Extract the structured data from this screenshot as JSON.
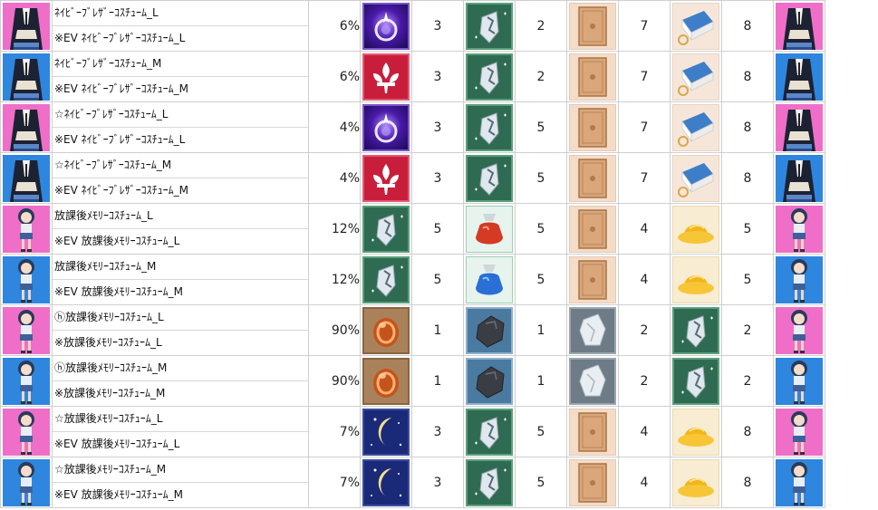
{
  "rows": [
    {
      "avatar_bg": "pink",
      "avatar": "blazer-costume-icon",
      "name_top": "ﾈｲﾋﾞｰﾌﾞﾚｻﾞｰｺｽﾁｭｰﾑ_L",
      "name_bottom": "※EV ﾈｲﾋﾞｰﾌﾞﾚｻﾞｰｺｽﾁｭｰﾑ_L",
      "rate": "6%",
      "m1": "purple-orb",
      "q1": "3",
      "m2": "shard-green",
      "q2": "2",
      "m3": "scroll",
      "q3": "7",
      "m4": "book",
      "q4": "8",
      "result_bg": "pink",
      "result": "blazer-costume-icon"
    },
    {
      "avatar_bg": "blue",
      "avatar": "blazer-costume-icon",
      "name_top": "ﾈｲﾋﾞｰﾌﾞﾚｻﾞｰｺｽﾁｭｰﾑ_M",
      "name_bottom": "※EV ﾈｲﾋﾞｰﾌﾞﾚｻﾞｰｺｽﾁｭｰﾑ_M",
      "rate": "6%",
      "m1": "fleur",
      "q1": "3",
      "m2": "shard-green",
      "q2": "2",
      "m3": "scroll",
      "q3": "7",
      "m4": "book",
      "q4": "8",
      "result_bg": "blue",
      "result": "blazer-costume-icon"
    },
    {
      "avatar_bg": "pink",
      "avatar": "blazer-costume-icon",
      "name_top": "☆ﾈｲﾋﾞｰﾌﾞﾚｻﾞｰｺｽﾁｭｰﾑ_L",
      "name_bottom": "※EV ﾈｲﾋﾞｰﾌﾞﾚｻﾞｰｺｽﾁｭｰﾑ_L",
      "rate": "4%",
      "m1": "purple-orb",
      "q1": "3",
      "m2": "shard-green",
      "q2": "5",
      "m3": "scroll",
      "q3": "7",
      "m4": "book",
      "q4": "8",
      "result_bg": "pink",
      "result": "blazer-costume-icon"
    },
    {
      "avatar_bg": "blue",
      "avatar": "blazer-costume-icon",
      "name_top": "☆ﾈｲﾋﾞｰﾌﾞﾚｻﾞｰｺｽﾁｭｰﾑ_M",
      "name_bottom": "※EV ﾈｲﾋﾞｰﾌﾞﾚｻﾞｰｺｽﾁｭｰﾑ_M",
      "rate": "4%",
      "m1": "fleur",
      "q1": "3",
      "m2": "shard-green",
      "q2": "5",
      "m3": "scroll",
      "q3": "7",
      "m4": "book",
      "q4": "8",
      "result_bg": "blue",
      "result": "blazer-costume-icon"
    },
    {
      "avatar_bg": "pink",
      "avatar": "memory-costume-icon",
      "name_top": "放課後ﾒﾓﾘｰｺｽﾁｭｰﾑ_L",
      "name_bottom": "※EV 放課後ﾒﾓﾘｰｺｽﾁｭｰﾑ_L",
      "rate": "12%",
      "m1": "shard-green",
      "q1": "5",
      "m2": "red-gem",
      "q2": "5",
      "m3": "scroll",
      "q3": "4",
      "m4": "hat",
      "q4": "5",
      "result_bg": "pink",
      "result": "memory-costume-icon"
    },
    {
      "avatar_bg": "blue",
      "avatar": "memory-costume-icon",
      "name_top": "放課後ﾒﾓﾘｰｺｽﾁｭｰﾑ_M",
      "name_bottom": "※EV 放課後ﾒﾓﾘｰｺｽﾁｭｰﾑ_M",
      "rate": "12%",
      "m1": "shard-green",
      "q1": "5",
      "m2": "blue-gem",
      "q2": "5",
      "m3": "scroll",
      "q3": "4",
      "m4": "hat",
      "q4": "5",
      "result_bg": "blue",
      "result": "memory-costume-icon"
    },
    {
      "avatar_bg": "pink",
      "avatar": "memory-costume-icon",
      "name_top": "ⓗ放課後ﾒﾓﾘｰｺｽﾁｭｰﾑ_L",
      "name_bottom": "※放課後ﾒﾓﾘｰｺｽﾁｭｰﾑ_L",
      "rate": "90%",
      "m1": "orange-orb",
      "q1": "1",
      "m2": "stone",
      "q2": "1",
      "m3": "crystal",
      "q3": "2",
      "m4": "shard-green",
      "q4": "2",
      "result_bg": "pink",
      "result": "memory-costume-icon"
    },
    {
      "avatar_bg": "blue",
      "avatar": "memory-costume-icon",
      "name_top": "ⓗ放課後ﾒﾓﾘｰｺｽﾁｭｰﾑ_M",
      "name_bottom": "※放課後ﾒﾓﾘｰｺｽﾁｭｰﾑ_M",
      "rate": "90%",
      "m1": "orange-orb",
      "q1": "1",
      "m2": "stone",
      "q2": "1",
      "m3": "crystal",
      "q3": "2",
      "m4": "shard-green",
      "q4": "2",
      "result_bg": "blue",
      "result": "memory-costume-icon"
    },
    {
      "avatar_bg": "pink",
      "avatar": "memory-costume-icon",
      "name_top": "☆放課後ﾒﾓﾘｰｺｽﾁｭｰﾑ_L",
      "name_bottom": "※EV 放課後ﾒﾓﾘｰｺｽﾁｭｰﾑ_L",
      "rate": "7%",
      "m1": "moon",
      "q1": "3",
      "m2": "shard-green",
      "q2": "5",
      "m3": "scroll",
      "q3": "4",
      "m4": "hat",
      "q4": "8",
      "result_bg": "pink",
      "result": "memory-costume-icon"
    },
    {
      "avatar_bg": "blue",
      "avatar": "memory-costume-icon",
      "name_top": "☆放課後ﾒﾓﾘｰｺｽﾁｭｰﾑ_M",
      "name_bottom": "※EV 放課後ﾒﾓﾘｰｺｽﾁｭｰﾑ_M",
      "rate": "7%",
      "m1": "moon",
      "q1": "3",
      "m2": "shard-green",
      "q2": "5",
      "m3": "scroll",
      "q3": "4",
      "m4": "hat",
      "q4": "8",
      "result_bg": "blue",
      "result": "memory-costume-icon"
    }
  ]
}
